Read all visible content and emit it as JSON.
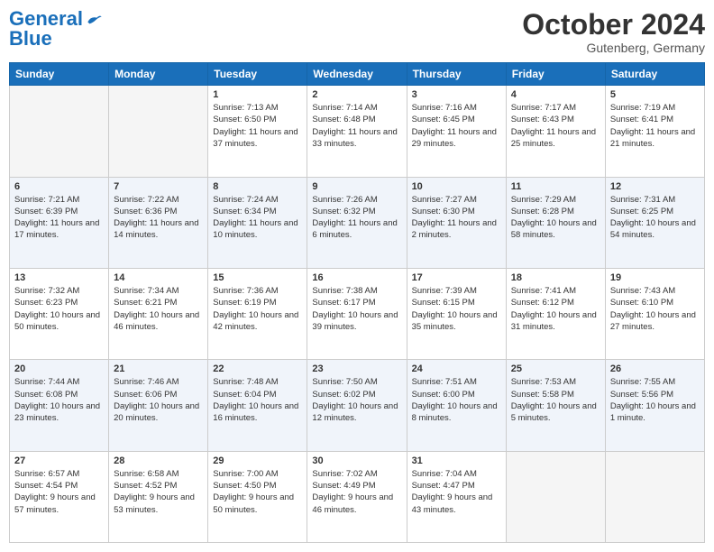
{
  "logo": {
    "text_general": "General",
    "text_blue": "Blue"
  },
  "header": {
    "month": "October 2024",
    "location": "Gutenberg, Germany"
  },
  "days": [
    "Sunday",
    "Monday",
    "Tuesday",
    "Wednesday",
    "Thursday",
    "Friday",
    "Saturday"
  ],
  "weeks": [
    [
      {
        "num": "",
        "info": ""
      },
      {
        "num": "",
        "info": ""
      },
      {
        "num": "1",
        "info": "Sunrise: 7:13 AM\nSunset: 6:50 PM\nDaylight: 11 hours\nand 37 minutes."
      },
      {
        "num": "2",
        "info": "Sunrise: 7:14 AM\nSunset: 6:48 PM\nDaylight: 11 hours\nand 33 minutes."
      },
      {
        "num": "3",
        "info": "Sunrise: 7:16 AM\nSunset: 6:45 PM\nDaylight: 11 hours\nand 29 minutes."
      },
      {
        "num": "4",
        "info": "Sunrise: 7:17 AM\nSunset: 6:43 PM\nDaylight: 11 hours\nand 25 minutes."
      },
      {
        "num": "5",
        "info": "Sunrise: 7:19 AM\nSunset: 6:41 PM\nDaylight: 11 hours\nand 21 minutes."
      }
    ],
    [
      {
        "num": "6",
        "info": "Sunrise: 7:21 AM\nSunset: 6:39 PM\nDaylight: 11 hours\nand 17 minutes."
      },
      {
        "num": "7",
        "info": "Sunrise: 7:22 AM\nSunset: 6:36 PM\nDaylight: 11 hours\nand 14 minutes."
      },
      {
        "num": "8",
        "info": "Sunrise: 7:24 AM\nSunset: 6:34 PM\nDaylight: 11 hours\nand 10 minutes."
      },
      {
        "num": "9",
        "info": "Sunrise: 7:26 AM\nSunset: 6:32 PM\nDaylight: 11 hours\nand 6 minutes."
      },
      {
        "num": "10",
        "info": "Sunrise: 7:27 AM\nSunset: 6:30 PM\nDaylight: 11 hours\nand 2 minutes."
      },
      {
        "num": "11",
        "info": "Sunrise: 7:29 AM\nSunset: 6:28 PM\nDaylight: 10 hours\nand 58 minutes."
      },
      {
        "num": "12",
        "info": "Sunrise: 7:31 AM\nSunset: 6:25 PM\nDaylight: 10 hours\nand 54 minutes."
      }
    ],
    [
      {
        "num": "13",
        "info": "Sunrise: 7:32 AM\nSunset: 6:23 PM\nDaylight: 10 hours\nand 50 minutes."
      },
      {
        "num": "14",
        "info": "Sunrise: 7:34 AM\nSunset: 6:21 PM\nDaylight: 10 hours\nand 46 minutes."
      },
      {
        "num": "15",
        "info": "Sunrise: 7:36 AM\nSunset: 6:19 PM\nDaylight: 10 hours\nand 42 minutes."
      },
      {
        "num": "16",
        "info": "Sunrise: 7:38 AM\nSunset: 6:17 PM\nDaylight: 10 hours\nand 39 minutes."
      },
      {
        "num": "17",
        "info": "Sunrise: 7:39 AM\nSunset: 6:15 PM\nDaylight: 10 hours\nand 35 minutes."
      },
      {
        "num": "18",
        "info": "Sunrise: 7:41 AM\nSunset: 6:12 PM\nDaylight: 10 hours\nand 31 minutes."
      },
      {
        "num": "19",
        "info": "Sunrise: 7:43 AM\nSunset: 6:10 PM\nDaylight: 10 hours\nand 27 minutes."
      }
    ],
    [
      {
        "num": "20",
        "info": "Sunrise: 7:44 AM\nSunset: 6:08 PM\nDaylight: 10 hours\nand 23 minutes."
      },
      {
        "num": "21",
        "info": "Sunrise: 7:46 AM\nSunset: 6:06 PM\nDaylight: 10 hours\nand 20 minutes."
      },
      {
        "num": "22",
        "info": "Sunrise: 7:48 AM\nSunset: 6:04 PM\nDaylight: 10 hours\nand 16 minutes."
      },
      {
        "num": "23",
        "info": "Sunrise: 7:50 AM\nSunset: 6:02 PM\nDaylight: 10 hours\nand 12 minutes."
      },
      {
        "num": "24",
        "info": "Sunrise: 7:51 AM\nSunset: 6:00 PM\nDaylight: 10 hours\nand 8 minutes."
      },
      {
        "num": "25",
        "info": "Sunrise: 7:53 AM\nSunset: 5:58 PM\nDaylight: 10 hours\nand 5 minutes."
      },
      {
        "num": "26",
        "info": "Sunrise: 7:55 AM\nSunset: 5:56 PM\nDaylight: 10 hours\nand 1 minute."
      }
    ],
    [
      {
        "num": "27",
        "info": "Sunrise: 6:57 AM\nSunset: 4:54 PM\nDaylight: 9 hours\nand 57 minutes."
      },
      {
        "num": "28",
        "info": "Sunrise: 6:58 AM\nSunset: 4:52 PM\nDaylight: 9 hours\nand 53 minutes."
      },
      {
        "num": "29",
        "info": "Sunrise: 7:00 AM\nSunset: 4:50 PM\nDaylight: 9 hours\nand 50 minutes."
      },
      {
        "num": "30",
        "info": "Sunrise: 7:02 AM\nSunset: 4:49 PM\nDaylight: 9 hours\nand 46 minutes."
      },
      {
        "num": "31",
        "info": "Sunrise: 7:04 AM\nSunset: 4:47 PM\nDaylight: 9 hours\nand 43 minutes."
      },
      {
        "num": "",
        "info": ""
      },
      {
        "num": "",
        "info": ""
      }
    ]
  ]
}
